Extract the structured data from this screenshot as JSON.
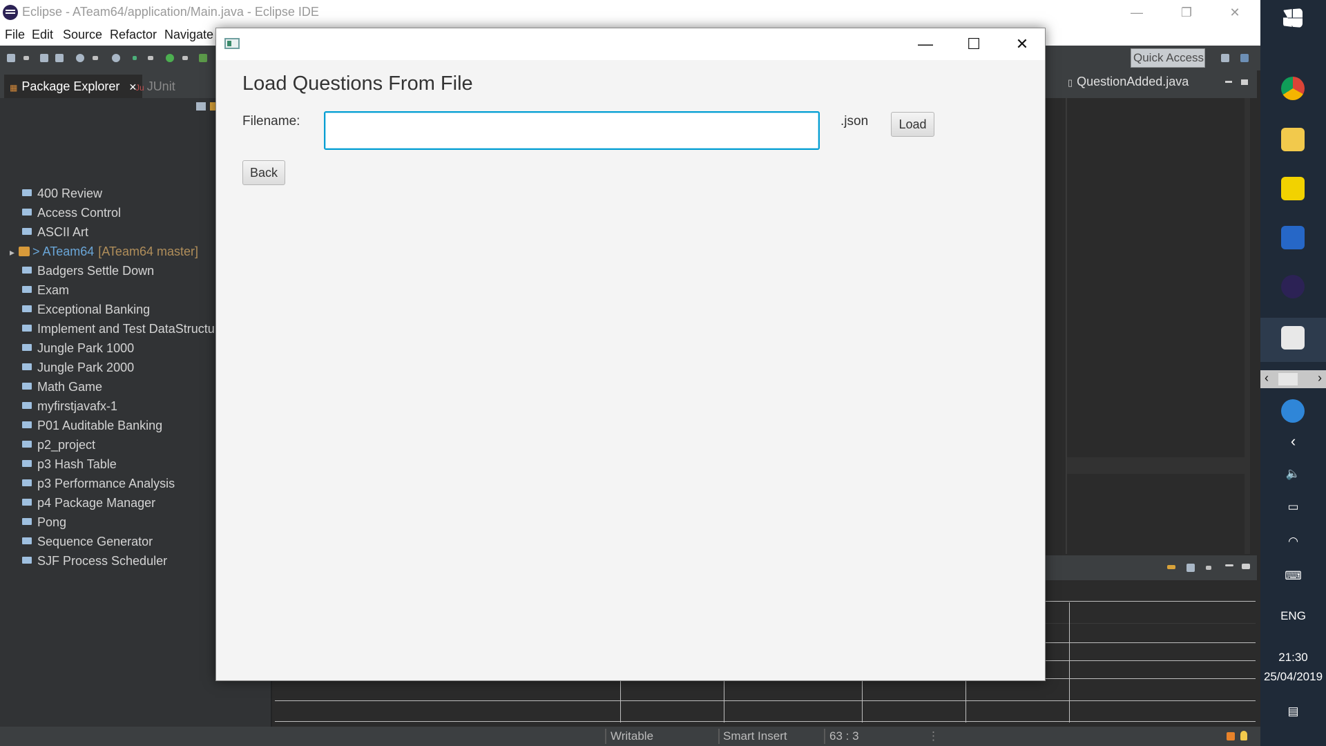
{
  "window": {
    "title": "Eclipse - ATeam64/application/Main.java - Eclipse IDE"
  },
  "menubar": [
    "File",
    "Edit",
    "Source",
    "Refactor",
    "Navigate"
  ],
  "toolbar": {
    "quick_access": "Quick Access"
  },
  "explorer": {
    "tabs": [
      {
        "label": "Package Explorer",
        "close": "✕",
        "active": true
      },
      {
        "label": "JUnit",
        "active": false
      }
    ],
    "items": [
      {
        "label": "400 Review"
      },
      {
        "label": "Access Control"
      },
      {
        "label": "ASCII Art"
      },
      {
        "label": "> ATeam64",
        "suffix": "[ATeam64 master]",
        "special": true
      },
      {
        "label": "Badgers Settle Down"
      },
      {
        "label": "Exam"
      },
      {
        "label": "Exceptional Banking"
      },
      {
        "label": "Implement and Test DataStructur"
      },
      {
        "label": "Jungle Park 1000"
      },
      {
        "label": "Jungle Park 2000"
      },
      {
        "label": "Math Game"
      },
      {
        "label": "myfirstjavafx-1"
      },
      {
        "label": "P01 Auditable Banking"
      },
      {
        "label": "p2_project"
      },
      {
        "label": "p3 Hash Table"
      },
      {
        "label": "p3 Performance Analysis"
      },
      {
        "label": "p4 Package Manager"
      },
      {
        "label": "Pong"
      },
      {
        "label": "Sequence Generator"
      },
      {
        "label": "SJF Process Scheduler"
      }
    ]
  },
  "editor": {
    "tab": "QuestionAdded.java"
  },
  "statusbar": {
    "writable": "Writable",
    "insert_mode": "Smart Insert",
    "position": "63 : 3"
  },
  "taskbar": {
    "language": "ENG",
    "time": "21:30",
    "date": "25/04/2019"
  },
  "dialog": {
    "heading": "Load Questions From File",
    "filename_label": "Filename:",
    "filename_value": "",
    "extension": ".json",
    "load_label": "Load",
    "back_label": "Back",
    "min_glyph": "—",
    "max_glyph": "☐",
    "close_glyph": "✕"
  },
  "colors": {
    "focus_border": "#039ed3",
    "ide_dark": "#2b2b2b",
    "dialog_bg": "#f4f4f4"
  }
}
